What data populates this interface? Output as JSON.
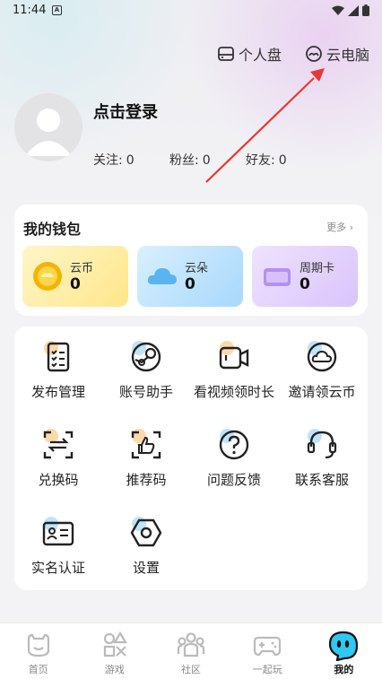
{
  "status_bar": {
    "time": "11:44",
    "sim_label": "A"
  },
  "top_links": {
    "disk_label": "个人盘",
    "cloud_pc_label": "云电脑"
  },
  "profile": {
    "login_label": "点击登录",
    "stats": [
      {
        "label": "关注:",
        "value": "0"
      },
      {
        "label": "粉丝:",
        "value": "0"
      },
      {
        "label": "好友:",
        "value": "0"
      }
    ]
  },
  "wallet": {
    "title": "我的钱包",
    "more_label": "更多 ›",
    "items": [
      {
        "label": "云币",
        "value": "0",
        "icon": "coin-icon"
      },
      {
        "label": "云朵",
        "value": "0",
        "icon": "cloud-icon"
      },
      {
        "label": "周期卡",
        "value": "0",
        "icon": "card-icon"
      }
    ]
  },
  "services": [
    {
      "label": "发布管理",
      "icon": "checklist-icon"
    },
    {
      "label": "账号助手",
      "icon": "steam-icon"
    },
    {
      "label": "看视频领时长",
      "icon": "video-camera-icon"
    },
    {
      "label": "邀请领云币",
      "icon": "cloud-invite-icon"
    },
    {
      "label": "兑换码",
      "icon": "exchange-icon"
    },
    {
      "label": "推荐码",
      "icon": "thumbs-up-icon"
    },
    {
      "label": "问题反馈",
      "icon": "question-icon"
    },
    {
      "label": "联系客服",
      "icon": "headset-icon"
    },
    {
      "label": "实名认证",
      "icon": "id-card-icon"
    },
    {
      "label": "设置",
      "icon": "settings-hexagon-icon"
    }
  ],
  "tabs": [
    {
      "label": "首页",
      "icon": "home-icon"
    },
    {
      "label": "游戏",
      "icon": "game-shapes-icon"
    },
    {
      "label": "社区",
      "icon": "community-icon"
    },
    {
      "label": "一起玩",
      "icon": "gamepad-icon"
    },
    {
      "label": "我的",
      "icon": "mascot-icon",
      "active": true
    }
  ],
  "colors": {
    "accent_red": "#e53935",
    "coin_orange": "#f5b400",
    "cloud_blue": "#5ab4f0",
    "card_purple": "#b590f0"
  }
}
